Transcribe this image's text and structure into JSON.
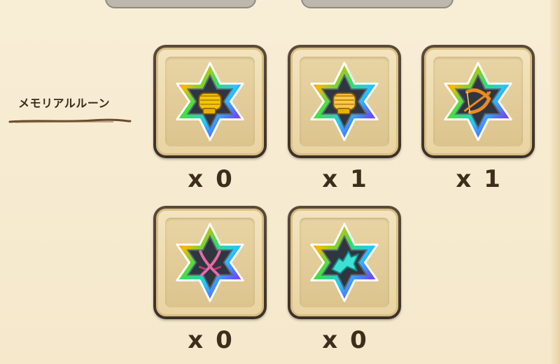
{
  "section": {
    "label": "メモリアルルーン"
  },
  "runes": [
    {
      "icon": "fist-icon",
      "prefix": "x",
      "count": "0",
      "symbol_color": "#f2c600"
    },
    {
      "icon": "fist-icon",
      "prefix": "x",
      "count": "1",
      "symbol_color": "#f7c84a"
    },
    {
      "icon": "bow-icon",
      "prefix": "x",
      "count": "1",
      "symbol_color": "#f08a1c"
    },
    {
      "icon": "crossed-swords-icon",
      "prefix": "x",
      "count": "0",
      "symbol_color": "#e86aa8"
    },
    {
      "icon": "wolf-icon",
      "prefix": "x",
      "count": "0",
      "symbol_color": "#3ee0d4"
    }
  ],
  "colors": {
    "background": "#f7ecd3",
    "frame": "#4a3a2c",
    "text": "#3d2e1c"
  }
}
